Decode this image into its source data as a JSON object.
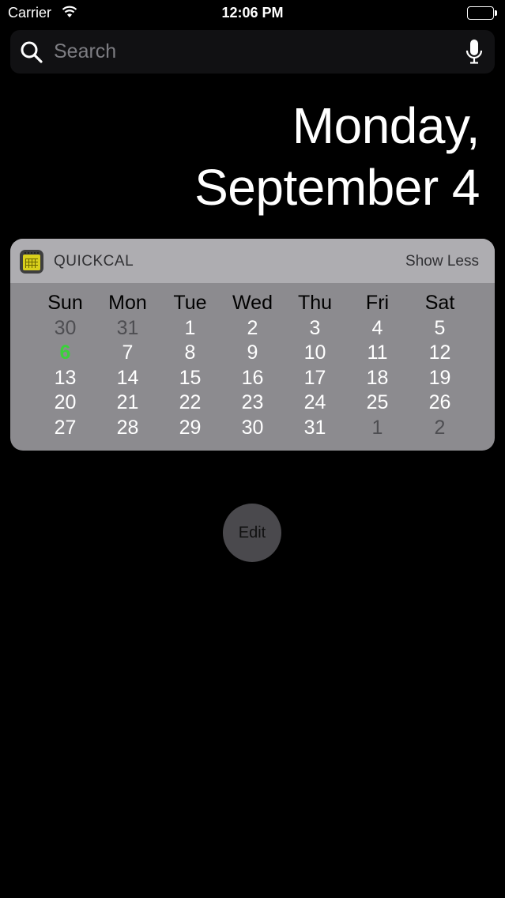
{
  "status_bar": {
    "carrier": "Carrier",
    "time": "12:06 PM",
    "wifi_icon": "wifi-icon",
    "battery_icon": "battery-icon"
  },
  "search": {
    "placeholder": "Search",
    "value": "",
    "search_icon": "search-icon",
    "mic_icon": "microphone-icon"
  },
  "date": {
    "line1": "Monday,",
    "line2": "September 4"
  },
  "widget": {
    "app_name": "QUICKCAL",
    "app_icon": "calendar-app-icon",
    "show_less_label": "Show Less",
    "weekdays": [
      "Sun",
      "Mon",
      "Tue",
      "Wed",
      "Thu",
      "Fri",
      "Sat"
    ],
    "weeks": [
      [
        {
          "d": "30",
          "muted": true
        },
        {
          "d": "31",
          "muted": true
        },
        {
          "d": "1"
        },
        {
          "d": "2"
        },
        {
          "d": "3"
        },
        {
          "d": "4"
        },
        {
          "d": "5"
        }
      ],
      [
        {
          "d": "6",
          "today": true
        },
        {
          "d": "7"
        },
        {
          "d": "8"
        },
        {
          "d": "9"
        },
        {
          "d": "10"
        },
        {
          "d": "11"
        },
        {
          "d": "12"
        }
      ],
      [
        {
          "d": "13"
        },
        {
          "d": "14"
        },
        {
          "d": "15"
        },
        {
          "d": "16"
        },
        {
          "d": "17"
        },
        {
          "d": "18"
        },
        {
          "d": "19"
        }
      ],
      [
        {
          "d": "20"
        },
        {
          "d": "21"
        },
        {
          "d": "22"
        },
        {
          "d": "23"
        },
        {
          "d": "24"
        },
        {
          "d": "25"
        },
        {
          "d": "26"
        }
      ],
      [
        {
          "d": "27"
        },
        {
          "d": "28"
        },
        {
          "d": "29"
        },
        {
          "d": "30"
        },
        {
          "d": "31"
        },
        {
          "d": "1",
          "muted": true
        },
        {
          "d": "2",
          "muted": true
        }
      ]
    ],
    "today_color": "#3ad23a"
  },
  "edit_label": "Edit"
}
